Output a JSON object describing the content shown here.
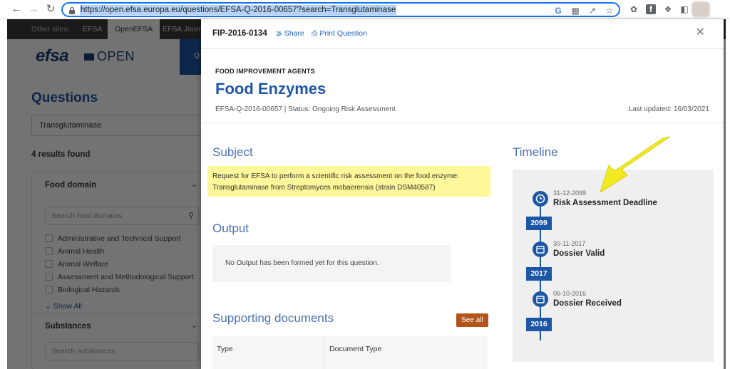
{
  "browser": {
    "url": "https://open.efsa.europa.eu/questions/EFSA-Q-2016-00657?search=Transglutaminase",
    "colors": {
      "url_highlight": "#b4d3f7",
      "url_border": "#1a73e8"
    }
  },
  "site": {
    "tabs": [
      "Other sites:",
      "EFSA",
      "OpenEFSA",
      "EFSA Journ"
    ],
    "logo": {
      "efsa": "efsa",
      "open": "OPEN"
    },
    "nav_partial": "Q",
    "questions_title": "Questions",
    "search_value": "Transglutaminase",
    "results": "4 results found",
    "food_domain": {
      "title": "Food domain",
      "search_placeholder": "Search food domains",
      "items": [
        "Administrative and Technical Support",
        "Animal Health",
        "Animal Welfare",
        "Assessment and Methodological Support",
        "Biological Hazards"
      ],
      "show_all": "Show All"
    },
    "substances": {
      "title": "Substances",
      "search_placeholder": "Search substances"
    }
  },
  "modal": {
    "id": "FIP-2016-0134",
    "share": "Share",
    "print": "Print Question",
    "category": "FOOD IMPROVEMENT AGENTS",
    "title": "Food Enzymes",
    "subline": "EFSA-Q-2016-00657 | Status: Ongoing Risk Assessment",
    "last_updated": "Last updated: 16/03/2021",
    "subject": {
      "heading": "Subject",
      "text": "Request for EFSA to perform a scientific risk assessment on the food enzyme: Transglutaminase from Streptomyces mobaerensis (strain DSM40587)"
    },
    "output": {
      "heading": "Output",
      "text": "No Output has been formed yet for this question."
    },
    "supporting": {
      "heading": "Supporting documents",
      "see_all": "See all",
      "columns": [
        "Type",
        "Document Type"
      ]
    },
    "timeline": {
      "heading": "Timeline",
      "events": [
        {
          "date": "31-12-2099",
          "label": "Risk Assessment Deadline",
          "icon": "clock-icon"
        },
        {
          "date": "30-11-2017",
          "label": "Dossier Valid",
          "icon": "calendar-icon"
        },
        {
          "date": "06-10-2016",
          "label": "Dossier Received",
          "icon": "calendar-icon"
        }
      ],
      "years": [
        "2099",
        "2017",
        "2016"
      ]
    },
    "colors": {
      "brand_blue": "#1d56a5",
      "highlight": "#fff799",
      "see_all": "#b5541a",
      "annotation": "#f2ea1e"
    }
  }
}
